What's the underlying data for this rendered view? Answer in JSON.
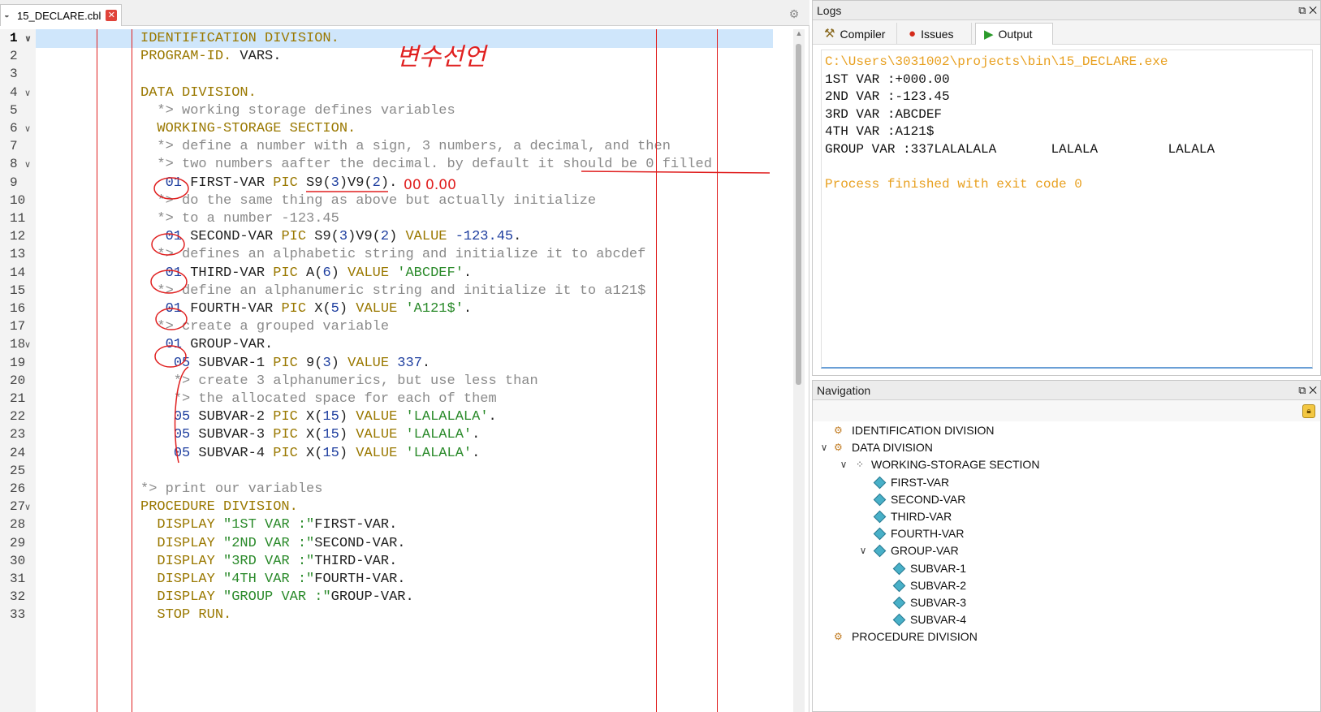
{
  "editor": {
    "tab_label": "15_DECLARE.cbl",
    "tab_close": "✕",
    "lines": [
      {
        "n": "1",
        "fold": "∨",
        "tokens": [
          {
            "t": "IDENTIFICATION DIVISION.",
            "c": "kw"
          }
        ]
      },
      {
        "n": "2",
        "fold": "",
        "tokens": [
          {
            "t": "PROGRAM-ID.",
            "c": "kw"
          },
          {
            "t": " VARS.",
            "c": "txt"
          }
        ]
      },
      {
        "n": "3",
        "fold": "",
        "tokens": []
      },
      {
        "n": "4",
        "fold": "∨",
        "tokens": [
          {
            "t": "DATA DIVISION.",
            "c": "kw"
          }
        ]
      },
      {
        "n": "5",
        "fold": "",
        "tokens": [
          {
            "t": "  *> working storage defines variables",
            "c": "cm"
          }
        ]
      },
      {
        "n": "6",
        "fold": "∨",
        "tokens": [
          {
            "t": "  WORKING-STORAGE SECTION.",
            "c": "kw"
          }
        ]
      },
      {
        "n": "7",
        "fold": "",
        "tokens": [
          {
            "t": "  *> define a number with a sign, 3 numbers, a decimal, and then",
            "c": "cm"
          }
        ]
      },
      {
        "n": "8",
        "fold": "∨",
        "tokens": [
          {
            "t": "  *> two numbers aafter the decimal. by default it should be 0 filled",
            "c": "cm"
          }
        ]
      },
      {
        "n": "9",
        "fold": "",
        "tokens": [
          {
            "t": "   ",
            "c": "txt"
          },
          {
            "t": "01",
            "c": "num"
          },
          {
            "t": " FIRST-VAR ",
            "c": "txt"
          },
          {
            "t": "PIC",
            "c": "kw"
          },
          {
            "t": " S9(",
            "c": "txt"
          },
          {
            "t": "3",
            "c": "num"
          },
          {
            "t": ")V9(",
            "c": "txt"
          },
          {
            "t": "2",
            "c": "num"
          },
          {
            "t": ").",
            "c": "txt"
          }
        ]
      },
      {
        "n": "10",
        "fold": "",
        "tokens": [
          {
            "t": "  *> do the same thing as above but actually initialize",
            "c": "cm"
          }
        ]
      },
      {
        "n": "11",
        "fold": "",
        "tokens": [
          {
            "t": "  *> to a number -123.45",
            "c": "cm"
          }
        ]
      },
      {
        "n": "12",
        "fold": "",
        "tokens": [
          {
            "t": "   ",
            "c": "txt"
          },
          {
            "t": "01",
            "c": "num"
          },
          {
            "t": " SECOND-VAR ",
            "c": "txt"
          },
          {
            "t": "PIC",
            "c": "kw"
          },
          {
            "t": " S9(",
            "c": "txt"
          },
          {
            "t": "3",
            "c": "num"
          },
          {
            "t": ")V9(",
            "c": "txt"
          },
          {
            "t": "2",
            "c": "num"
          },
          {
            "t": ") ",
            "c": "txt"
          },
          {
            "t": "VALUE",
            "c": "kw"
          },
          {
            "t": " ",
            "c": "txt"
          },
          {
            "t": "-123.45",
            "c": "num"
          },
          {
            "t": ".",
            "c": "txt"
          }
        ]
      },
      {
        "n": "13",
        "fold": "",
        "tokens": [
          {
            "t": "  *> defines an alphabetic string and initialize it to abcdef",
            "c": "cm"
          }
        ]
      },
      {
        "n": "14",
        "fold": "",
        "tokens": [
          {
            "t": "   ",
            "c": "txt"
          },
          {
            "t": "01",
            "c": "num"
          },
          {
            "t": " THIRD-VAR ",
            "c": "txt"
          },
          {
            "t": "PIC",
            "c": "kw"
          },
          {
            "t": " A(",
            "c": "txt"
          },
          {
            "t": "6",
            "c": "num"
          },
          {
            "t": ") ",
            "c": "txt"
          },
          {
            "t": "VALUE",
            "c": "kw"
          },
          {
            "t": " ",
            "c": "txt"
          },
          {
            "t": "'ABCDEF'",
            "c": "str"
          },
          {
            "t": ".",
            "c": "txt"
          }
        ]
      },
      {
        "n": "15",
        "fold": "",
        "tokens": [
          {
            "t": "  *> define an alphanumeric string and initialize it to a121$",
            "c": "cm"
          }
        ]
      },
      {
        "n": "16",
        "fold": "",
        "tokens": [
          {
            "t": "   ",
            "c": "txt"
          },
          {
            "t": "01",
            "c": "num"
          },
          {
            "t": " FOURTH-VAR ",
            "c": "txt"
          },
          {
            "t": "PIC",
            "c": "kw"
          },
          {
            "t": " X(",
            "c": "txt"
          },
          {
            "t": "5",
            "c": "num"
          },
          {
            "t": ") ",
            "c": "txt"
          },
          {
            "t": "VALUE",
            "c": "kw"
          },
          {
            "t": " ",
            "c": "txt"
          },
          {
            "t": "'A121$'",
            "c": "str"
          },
          {
            "t": ".",
            "c": "txt"
          }
        ]
      },
      {
        "n": "17",
        "fold": "",
        "tokens": [
          {
            "t": "  *> create a grouped variable",
            "c": "cm"
          }
        ]
      },
      {
        "n": "18",
        "fold": "∨",
        "tokens": [
          {
            "t": "   ",
            "c": "txt"
          },
          {
            "t": "01",
            "c": "num"
          },
          {
            "t": " GROUP-VAR.",
            "c": "txt"
          }
        ]
      },
      {
        "n": "19",
        "fold": "",
        "tokens": [
          {
            "t": "    ",
            "c": "txt"
          },
          {
            "t": "05",
            "c": "num"
          },
          {
            "t": " SUBVAR-1 ",
            "c": "txt"
          },
          {
            "t": "PIC",
            "c": "kw"
          },
          {
            "t": " 9(",
            "c": "txt"
          },
          {
            "t": "3",
            "c": "num"
          },
          {
            "t": ") ",
            "c": "txt"
          },
          {
            "t": "VALUE",
            "c": "kw"
          },
          {
            "t": " ",
            "c": "txt"
          },
          {
            "t": "337",
            "c": "num"
          },
          {
            "t": ".",
            "c": "txt"
          }
        ]
      },
      {
        "n": "20",
        "fold": "",
        "tokens": [
          {
            "t": "    *> create 3 alphanumerics, but use less than",
            "c": "cm"
          }
        ]
      },
      {
        "n": "21",
        "fold": "",
        "tokens": [
          {
            "t": "    *> the allocated space for each of them",
            "c": "cm"
          }
        ]
      },
      {
        "n": "22",
        "fold": "",
        "tokens": [
          {
            "t": "    ",
            "c": "txt"
          },
          {
            "t": "05",
            "c": "num"
          },
          {
            "t": " SUBVAR-2 ",
            "c": "txt"
          },
          {
            "t": "PIC",
            "c": "kw"
          },
          {
            "t": " X(",
            "c": "txt"
          },
          {
            "t": "15",
            "c": "num"
          },
          {
            "t": ") ",
            "c": "txt"
          },
          {
            "t": "VALUE",
            "c": "kw"
          },
          {
            "t": " ",
            "c": "txt"
          },
          {
            "t": "'LALALALA'",
            "c": "str"
          },
          {
            "t": ".",
            "c": "txt"
          }
        ]
      },
      {
        "n": "23",
        "fold": "",
        "tokens": [
          {
            "t": "    ",
            "c": "txt"
          },
          {
            "t": "05",
            "c": "num"
          },
          {
            "t": " SUBVAR-3 ",
            "c": "txt"
          },
          {
            "t": "PIC",
            "c": "kw"
          },
          {
            "t": " X(",
            "c": "txt"
          },
          {
            "t": "15",
            "c": "num"
          },
          {
            "t": ") ",
            "c": "txt"
          },
          {
            "t": "VALUE",
            "c": "kw"
          },
          {
            "t": " ",
            "c": "txt"
          },
          {
            "t": "'LALALA'",
            "c": "str"
          },
          {
            "t": ".",
            "c": "txt"
          }
        ]
      },
      {
        "n": "24",
        "fold": "",
        "tokens": [
          {
            "t": "    ",
            "c": "txt"
          },
          {
            "t": "05",
            "c": "num"
          },
          {
            "t": " SUBVAR-4 ",
            "c": "txt"
          },
          {
            "t": "PIC",
            "c": "kw"
          },
          {
            "t": " X(",
            "c": "txt"
          },
          {
            "t": "15",
            "c": "num"
          },
          {
            "t": ") ",
            "c": "txt"
          },
          {
            "t": "VALUE",
            "c": "kw"
          },
          {
            "t": " ",
            "c": "txt"
          },
          {
            "t": "'LALALA'",
            "c": "str"
          },
          {
            "t": ".",
            "c": "txt"
          }
        ]
      },
      {
        "n": "25",
        "fold": "",
        "tokens": []
      },
      {
        "n": "26",
        "fold": "",
        "tokens": [
          {
            "t": "*> print our variables",
            "c": "cm"
          }
        ]
      },
      {
        "n": "27",
        "fold": "∨",
        "tokens": [
          {
            "t": "PROCEDURE DIVISION.",
            "c": "kw"
          }
        ]
      },
      {
        "n": "28",
        "fold": "",
        "tokens": [
          {
            "t": "  DISPLAY ",
            "c": "kw"
          },
          {
            "t": "\"1ST VAR :\"",
            "c": "str"
          },
          {
            "t": "FIRST-VAR.",
            "c": "txt"
          }
        ]
      },
      {
        "n": "29",
        "fold": "",
        "tokens": [
          {
            "t": "  DISPLAY ",
            "c": "kw"
          },
          {
            "t": "\"2ND VAR :\"",
            "c": "str"
          },
          {
            "t": "SECOND-VAR.",
            "c": "txt"
          }
        ]
      },
      {
        "n": "30",
        "fold": "",
        "tokens": [
          {
            "t": "  DISPLAY ",
            "c": "kw"
          },
          {
            "t": "\"3RD VAR :\"",
            "c": "str"
          },
          {
            "t": "THIRD-VAR.",
            "c": "txt"
          }
        ]
      },
      {
        "n": "31",
        "fold": "",
        "tokens": [
          {
            "t": "  DISPLAY ",
            "c": "kw"
          },
          {
            "t": "\"4TH VAR :\"",
            "c": "str"
          },
          {
            "t": "FOURTH-VAR.",
            "c": "txt"
          }
        ]
      },
      {
        "n": "32",
        "fold": "",
        "tokens": [
          {
            "t": "  DISPLAY ",
            "c": "kw"
          },
          {
            "t": "\"GROUP VAR :\"",
            "c": "str"
          },
          {
            "t": "GROUP-VAR.",
            "c": "txt"
          }
        ]
      },
      {
        "n": "33",
        "fold": "",
        "tokens": [
          {
            "t": "  STOP RUN.",
            "c": "kw"
          }
        ]
      }
    ],
    "handwritten_note": "변수선언",
    "handwritten_digits": "00 0.00"
  },
  "logs": {
    "title": "Logs",
    "controls": "⧉ ✕",
    "tabs": [
      {
        "label": "Compiler",
        "icon": "hammer-icon",
        "glyph": "⚒",
        "color": "#8a6a20"
      },
      {
        "label": "Issues",
        "icon": "error-icon",
        "glyph": "●",
        "color": "#d42a1a"
      },
      {
        "label": "Output",
        "icon": "play-icon",
        "glyph": "▶",
        "color": "#2a9a2a"
      }
    ],
    "output": [
      {
        "text": "C:\\Users\\3031002\\projects\\bin\\15_DECLARE.exe",
        "style": "orange"
      },
      {
        "text": "1ST VAR :+000.00",
        "style": "normal"
      },
      {
        "text": "2ND VAR :-123.45",
        "style": "normal"
      },
      {
        "text": "3RD VAR :ABCDEF",
        "style": "normal"
      },
      {
        "text": "4TH VAR :A121$",
        "style": "normal"
      },
      {
        "text": "GROUP VAR :337LALALALA       LALALA         LALALA",
        "style": "normal"
      },
      {
        "text": "",
        "style": "normal"
      },
      {
        "text": "Process finished with exit code 0",
        "style": "orange"
      }
    ]
  },
  "navigation": {
    "title": "Navigation",
    "controls": "⧉ ✕",
    "items": [
      {
        "label": "IDENTIFICATION DIVISION",
        "level": 0,
        "expander": "",
        "icon": "division-icon"
      },
      {
        "label": "DATA DIVISION",
        "level": 0,
        "expander": "∨",
        "icon": "division-icon"
      },
      {
        "label": "WORKING-STORAGE SECTION",
        "level": 1,
        "expander": "∨",
        "icon": "section-icon"
      },
      {
        "label": "FIRST-VAR",
        "level": 2,
        "expander": "",
        "icon": "variable-icon"
      },
      {
        "label": "SECOND-VAR",
        "level": 2,
        "expander": "",
        "icon": "variable-icon"
      },
      {
        "label": "THIRD-VAR",
        "level": 2,
        "expander": "",
        "icon": "variable-icon"
      },
      {
        "label": "FOURTH-VAR",
        "level": 2,
        "expander": "",
        "icon": "variable-icon"
      },
      {
        "label": "GROUP-VAR",
        "level": 2,
        "expander": "∨",
        "icon": "variable-icon"
      },
      {
        "label": "SUBVAR-1",
        "level": 3,
        "expander": "",
        "icon": "variable-icon"
      },
      {
        "label": "SUBVAR-2",
        "level": 3,
        "expander": "",
        "icon": "variable-icon"
      },
      {
        "label": "SUBVAR-3",
        "level": 3,
        "expander": "",
        "icon": "variable-icon"
      },
      {
        "label": "SUBVAR-4",
        "level": 3,
        "expander": "",
        "icon": "variable-icon"
      },
      {
        "label": "PROCEDURE DIVISION",
        "level": 0,
        "expander": "",
        "icon": "division-icon"
      }
    ]
  },
  "colors": {
    "annotation_red": "#e02020",
    "output_orange": "#e8a020",
    "current_line": "#cfe6fb"
  }
}
